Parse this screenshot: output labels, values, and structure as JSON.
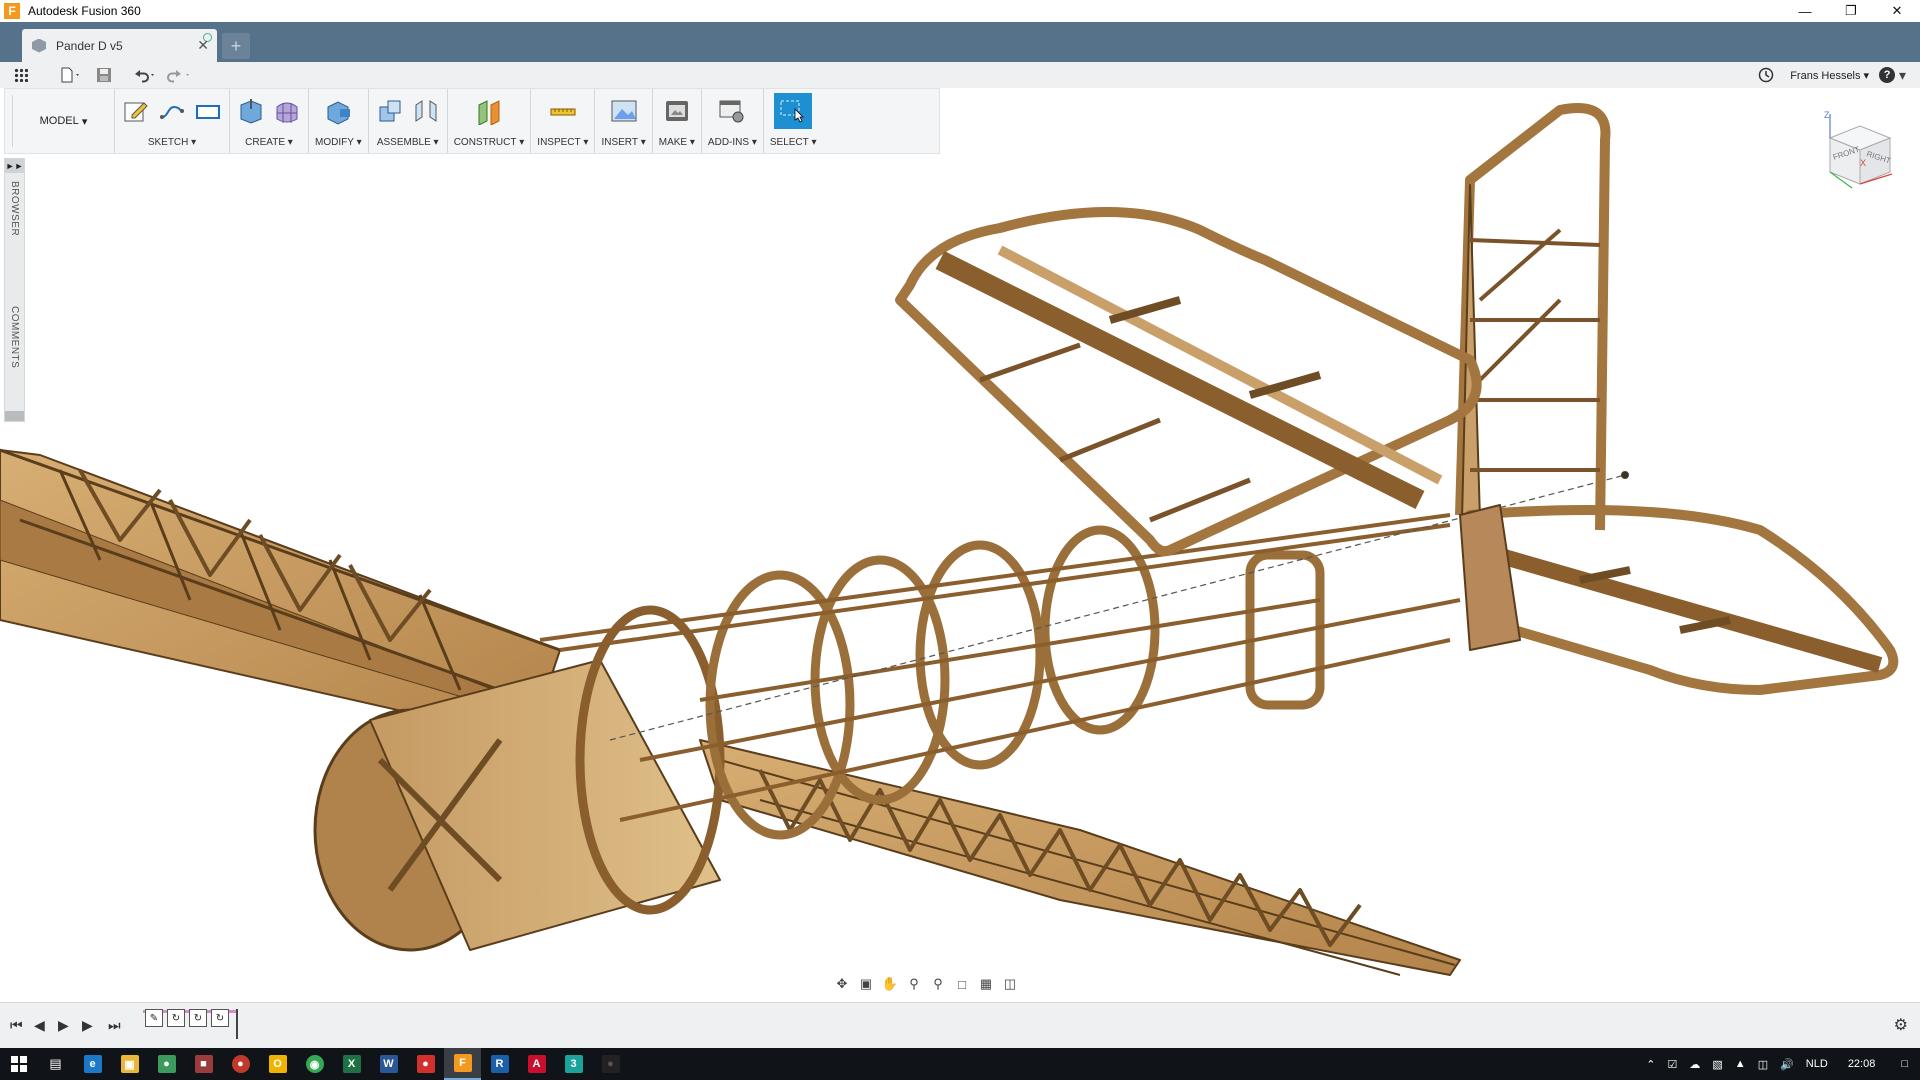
{
  "window": {
    "title": "Autodesk Fusion 360",
    "app_icon_letter": "F"
  },
  "tabs": {
    "active_doc": "Pander D v5",
    "new_tab_label": "+"
  },
  "qat": {
    "user_name": "Frans Hessels",
    "help_label": "?"
  },
  "toolbar": {
    "workspace": "MODEL",
    "groups": [
      {
        "label": "SKETCH",
        "icons": [
          "create-sketch-icon",
          "line-icon",
          "rectangle-icon"
        ]
      },
      {
        "label": "CREATE",
        "icons": [
          "extrude-icon",
          "form-icon"
        ]
      },
      {
        "label": "MODIFY",
        "icons": [
          "press-pull-icon"
        ]
      },
      {
        "label": "ASSEMBLE",
        "icons": [
          "new-component-icon",
          "joint-icon"
        ]
      },
      {
        "label": "CONSTRUCT",
        "icons": [
          "offset-plane-icon"
        ]
      },
      {
        "label": "INSPECT",
        "icons": [
          "measure-icon"
        ]
      },
      {
        "label": "INSERT",
        "icons": [
          "insert-image-icon"
        ]
      },
      {
        "label": "MAKE",
        "icons": [
          "3d-print-icon"
        ]
      },
      {
        "label": "ADD-INS",
        "icons": [
          "scripts-icon"
        ]
      },
      {
        "label": "SELECT",
        "icons": [
          "select-icon"
        ]
      }
    ]
  },
  "side_panel": {
    "browser": "BROWSER",
    "comments": "COMMENTS"
  },
  "viewcube": {
    "front": "FRONT",
    "right": "RIGHT",
    "axis_z": "Z",
    "axis_x": "X"
  },
  "taskbar": {
    "language": "NLD",
    "time": "22:08"
  },
  "colors": {
    "tab_bar": "#56718a",
    "wood": "#c79a5f",
    "wood_dark": "#6b4a22",
    "select_accent": "#1e8fd1"
  }
}
